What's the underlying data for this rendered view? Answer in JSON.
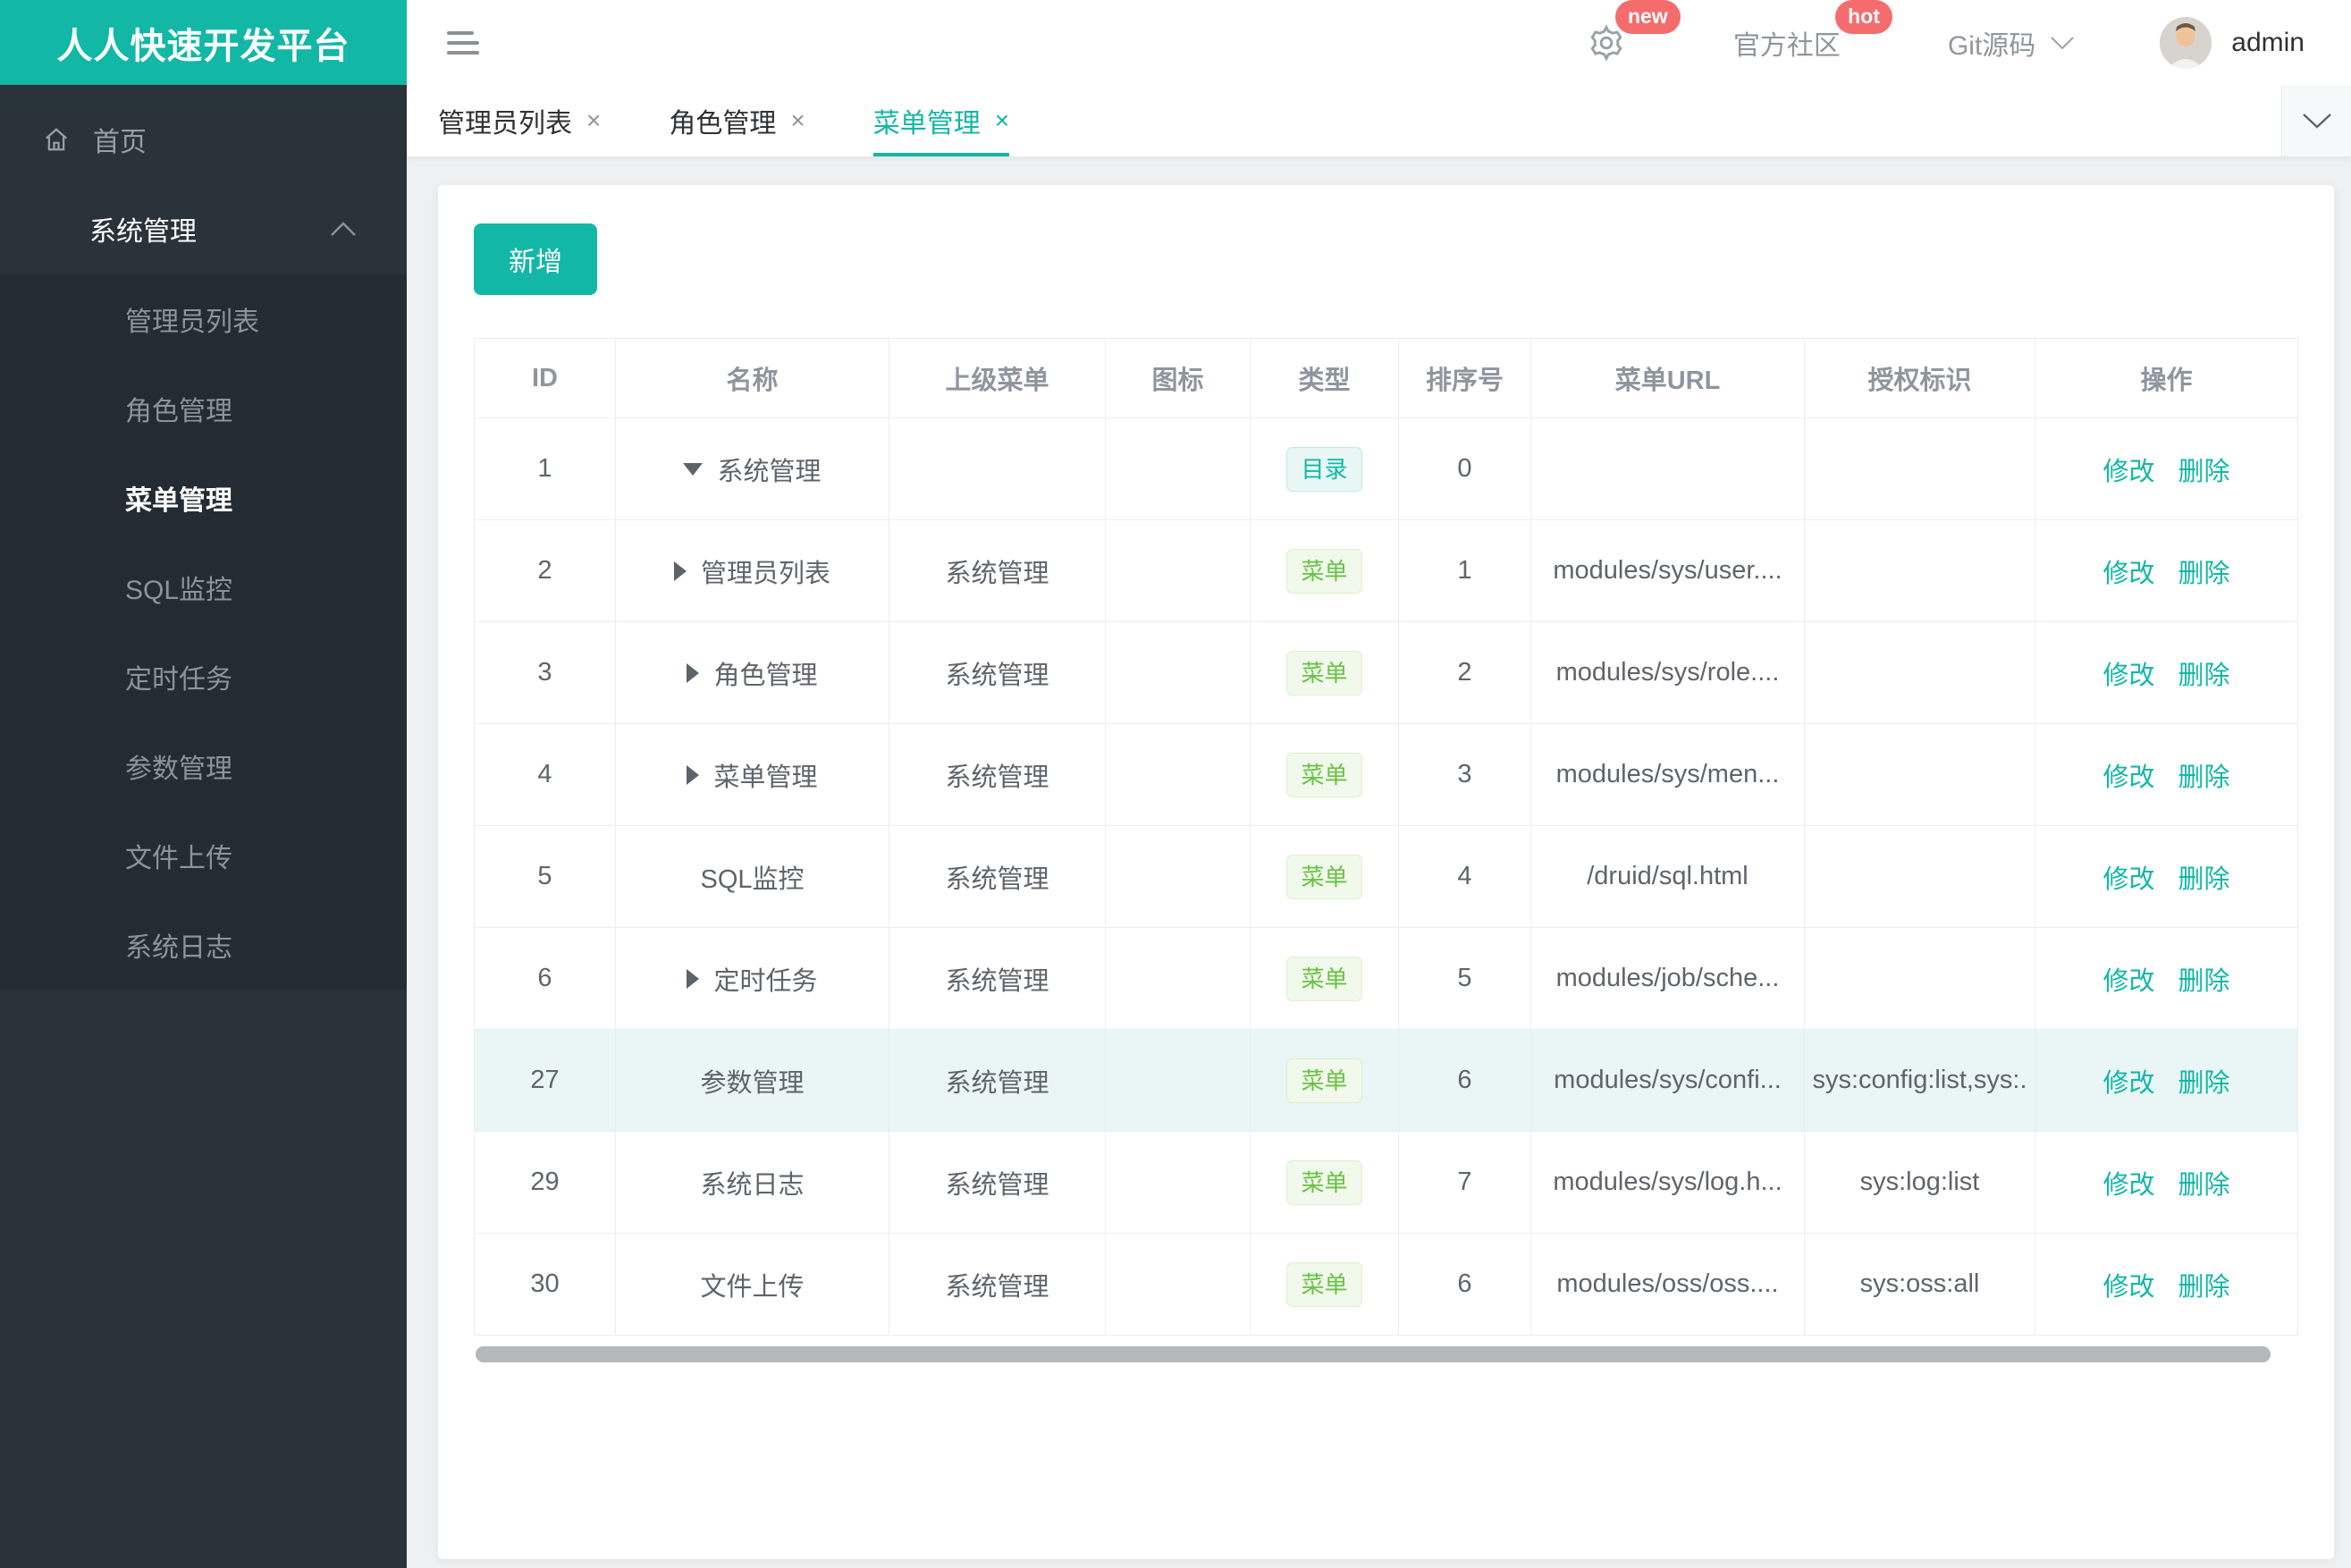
{
  "brand": {
    "logo_text": "人人快速开发平台",
    "accent_color": "#12b7a6"
  },
  "header": {
    "community_label": "官方社区",
    "git_label": "Git源码",
    "username": "admin",
    "badges": {
      "gear": "new",
      "community": "hot"
    },
    "badge_color": "#f56c6c"
  },
  "sidebar": {
    "home": "首页",
    "group": "系统管理",
    "items": [
      "管理员列表",
      "角色管理",
      "菜单管理",
      "SQL监控",
      "定时任务",
      "参数管理",
      "文件上传",
      "系统日志"
    ],
    "active_item": "菜单管理"
  },
  "tabs": [
    {
      "label": "管理员列表",
      "active": false
    },
    {
      "label": "角色管理",
      "active": false
    },
    {
      "label": "菜单管理",
      "active": true
    }
  ],
  "icons": {
    "close": "×"
  },
  "toolbar": {
    "add_label": "新增"
  },
  "table": {
    "columns": [
      "ID",
      "名称",
      "上级菜单",
      "图标",
      "类型",
      "排序号",
      "菜单URL",
      "授权标识",
      "操作"
    ],
    "actions": {
      "edit": "修改",
      "delete": "删除"
    },
    "tag_colors": {
      "dir_text": "#12b7a6",
      "menu_text": "#6ac144"
    },
    "highlight_row_color": "#e9f6f5",
    "rows": [
      {
        "id": "1",
        "arrow": "down",
        "name": "系统管理",
        "parent": "",
        "icon": "",
        "type": "目录",
        "type_kind": "dir",
        "order": "0",
        "url": "",
        "perm": "",
        "highlight": false
      },
      {
        "id": "2",
        "arrow": "right",
        "name": "管理员列表",
        "parent": "系统管理",
        "icon": "",
        "type": "菜单",
        "type_kind": "menu",
        "order": "1",
        "url": "modules/sys/user....",
        "perm": "",
        "highlight": false
      },
      {
        "id": "3",
        "arrow": "right",
        "name": "角色管理",
        "parent": "系统管理",
        "icon": "",
        "type": "菜单",
        "type_kind": "menu",
        "order": "2",
        "url": "modules/sys/role....",
        "perm": "",
        "highlight": false
      },
      {
        "id": "4",
        "arrow": "right",
        "name": "菜单管理",
        "parent": "系统管理",
        "icon": "",
        "type": "菜单",
        "type_kind": "menu",
        "order": "3",
        "url": "modules/sys/men...",
        "perm": "",
        "highlight": false
      },
      {
        "id": "5",
        "arrow": "none",
        "name": "SQL监控",
        "parent": "系统管理",
        "icon": "",
        "type": "菜单",
        "type_kind": "menu",
        "order": "4",
        "url": "/druid/sql.html",
        "perm": "",
        "highlight": false
      },
      {
        "id": "6",
        "arrow": "right",
        "name": "定时任务",
        "parent": "系统管理",
        "icon": "",
        "type": "菜单",
        "type_kind": "menu",
        "order": "5",
        "url": "modules/job/sche...",
        "perm": "",
        "highlight": false
      },
      {
        "id": "27",
        "arrow": "none",
        "name": "参数管理",
        "parent": "系统管理",
        "icon": "",
        "type": "菜单",
        "type_kind": "menu",
        "order": "6",
        "url": "modules/sys/confi...",
        "perm": "sys:config:list,sys:.",
        "highlight": true
      },
      {
        "id": "29",
        "arrow": "none",
        "name": "系统日志",
        "parent": "系统管理",
        "icon": "",
        "type": "菜单",
        "type_kind": "menu",
        "order": "7",
        "url": "modules/sys/log.h...",
        "perm": "sys:log:list",
        "highlight": false
      },
      {
        "id": "30",
        "arrow": "none",
        "name": "文件上传",
        "parent": "系统管理",
        "icon": "",
        "type": "菜单",
        "type_kind": "menu",
        "order": "6",
        "url": "modules/oss/oss....",
        "perm": "sys:oss:all",
        "highlight": false
      }
    ]
  }
}
